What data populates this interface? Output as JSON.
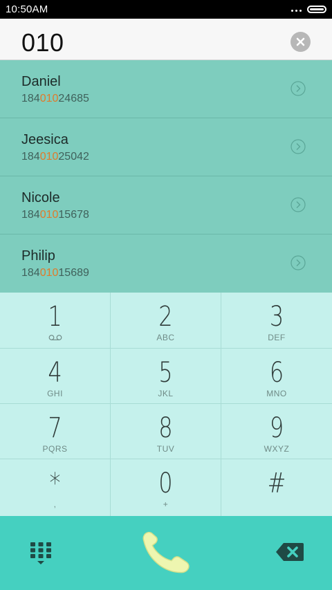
{
  "status_bar": {
    "time": "10:50AM"
  },
  "search": {
    "query": "010"
  },
  "results": [
    {
      "name": "Daniel",
      "phone_prefix": "184",
      "phone_match": "010",
      "phone_suffix": "24685"
    },
    {
      "name": "Jeesica",
      "phone_prefix": "184",
      "phone_match": "010",
      "phone_suffix": "25042"
    },
    {
      "name": "Nicole",
      "phone_prefix": "184",
      "phone_match": "010",
      "phone_suffix": "15678"
    },
    {
      "name": "Philip",
      "phone_prefix": "184",
      "phone_match": "010",
      "phone_suffix": "15689"
    }
  ],
  "keypad": [
    {
      "digit": "1",
      "letters": ""
    },
    {
      "digit": "2",
      "letters": "ABC"
    },
    {
      "digit": "3",
      "letters": "DEF"
    },
    {
      "digit": "4",
      "letters": "GHI"
    },
    {
      "digit": "5",
      "letters": "JKL"
    },
    {
      "digit": "6",
      "letters": "MNO"
    },
    {
      "digit": "7",
      "letters": "PQRS"
    },
    {
      "digit": "8",
      "letters": "TUV"
    },
    {
      "digit": "9",
      "letters": "WXYZ"
    },
    {
      "digit": "*",
      "letters": ","
    },
    {
      "digit": "0",
      "letters": "+"
    },
    {
      "digit": "#",
      "letters": ""
    }
  ],
  "icons": {
    "voicemail": "voicemail-icon",
    "clear": "clear-icon",
    "arrow": "chevron-right-circle-icon",
    "dialpad": "dialpad-icon",
    "call": "phone-handset-icon",
    "backspace": "backspace-icon"
  },
  "colors": {
    "results_bg": "#7ecdbe",
    "match_highlight": "#e07a2a",
    "keypad_bg": "#c2f0eb",
    "actionbar_bg": "#45d0c0",
    "call_button": "#eef6b0"
  }
}
